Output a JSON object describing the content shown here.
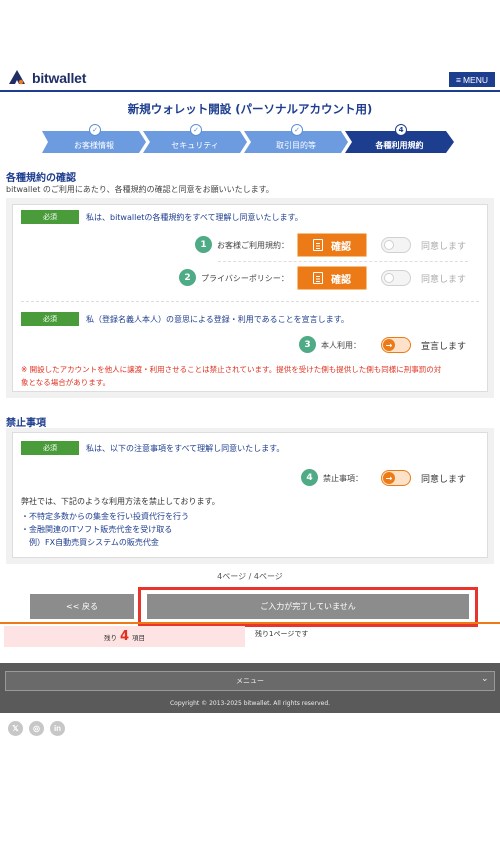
{
  "header": {
    "logo_text": "bitwallet",
    "menu_label": "MENU",
    "brand_color": "#1d3d8f"
  },
  "page_title": "新規ウォレット開設 (パーソナルアカウント用)",
  "steps": [
    {
      "label": "お客様情報",
      "status": "done"
    },
    {
      "label": "セキュリティ",
      "status": "done"
    },
    {
      "label": "取引目的等",
      "status": "done"
    },
    {
      "label": "各種利用規約",
      "status": "current",
      "number": "4"
    }
  ],
  "terms": {
    "heading": "各種規約の確認",
    "subtitle": "bitwallet のご利用にあたり、各種規約の確認と同意をお願いいたします。",
    "block1": {
      "badge": "必須",
      "statement": "私は、bitwalletの各種規約をすべて理解し同意いたします。",
      "rows": [
        {
          "num": "1",
          "label": "お客様ご利用規約：",
          "button": "確認",
          "toggle_label": "同意します",
          "checked": false
        },
        {
          "num": "2",
          "label": "プライバシーポリシー：",
          "button": "確認",
          "toggle_label": "同意します",
          "checked": false
        }
      ]
    },
    "block2": {
      "badge": "必須",
      "statement": "私（登録名義人本人）の意思による登録・利用であることを宣言します。",
      "row": {
        "num": "3",
        "label": "本人利用：",
        "toggle_label": "宣言します",
        "checked": true
      },
      "warning_line1": "※ 開設したアカウントを他人に譲渡・利用させることは禁止されています。提供を受けた側も提供した側も同様に刑事罰の対",
      "warning_line2": "象となる場合があります。"
    }
  },
  "prohibited": {
    "heading": "禁止事項",
    "badge": "必須",
    "statement": "私は、以下の注意事項をすべて理解し同意いたします。",
    "row": {
      "num": "4",
      "label": "禁止事項：",
      "toggle_label": "同意します",
      "checked": true
    },
    "notice": "弊社では、下記のような利用方法を禁止しております。",
    "items": [
      "・不特定多数からの集金を行い投資代行を行う",
      "・金融関連のITソフト販売代金を受け取る",
      "　例）FX自動売買システムの販売代金"
    ]
  },
  "pagination": {
    "text": "4ページ / 4ページ"
  },
  "actions": {
    "back_label": "<< 戻る",
    "submit_label": "ご入力が完了していません"
  },
  "remaining": {
    "prefix": "残り",
    "count": "4",
    "suffix": "項目",
    "pages_text": "残り1ページです"
  },
  "footer": {
    "menu_label": "メニュー",
    "copyright": "Copyright © 2013-2025 bitwallet. All rights reserved."
  },
  "social": [
    {
      "icon": "x-icon",
      "glyph": "𝕏"
    },
    {
      "icon": "instagram-icon",
      "glyph": "◎"
    },
    {
      "icon": "linkedin-icon",
      "glyph": "in"
    }
  ],
  "colors": {
    "accent_orange": "#ec7a16",
    "required_green": "#4a9b3a",
    "step_done": "#6c9be0",
    "step_current": "#1d3d8f",
    "warning_red": "#e0301e"
  }
}
